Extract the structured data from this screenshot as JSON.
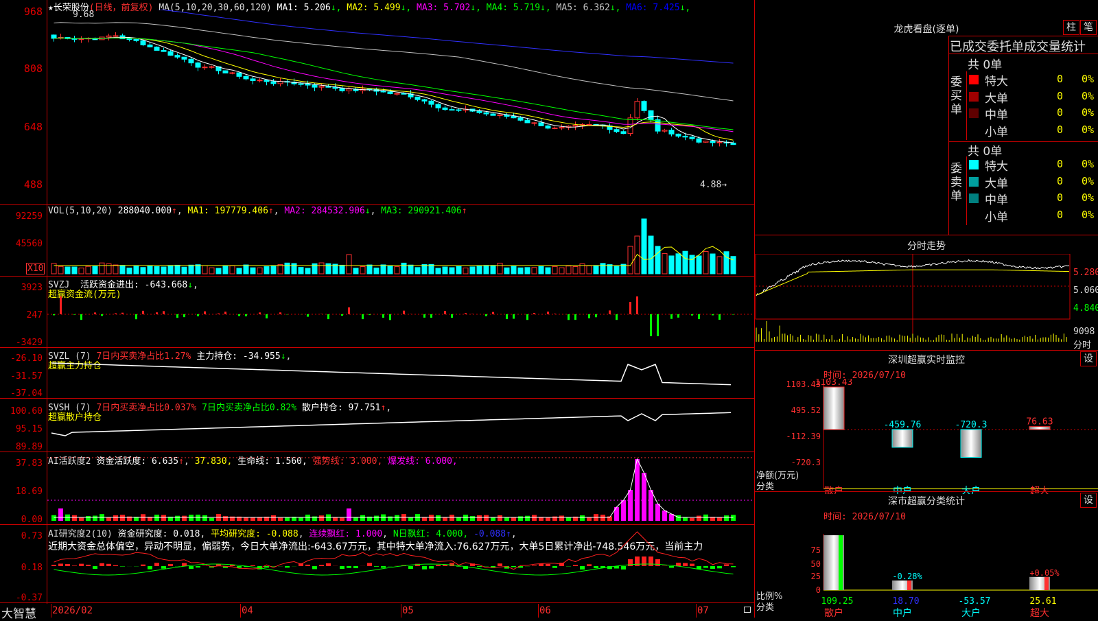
{
  "stock": {
    "star": "★",
    "name": "长荣股份",
    "period": "(日线，前复权)",
    "ma_header": "MA(5,10,20,30,60,120)",
    "ma_values": [
      {
        "label": "MA1:",
        "value": "5.206",
        "arrow": "↓",
        "color": "#ffffff"
      },
      {
        "label": "MA2:",
        "value": "5.499",
        "arrow": "↓",
        "color": "#ffff00"
      },
      {
        "label": "MA3:",
        "value": "5.702",
        "arrow": "↓",
        "color": "#ff00ff"
      },
      {
        "label": "MA4:",
        "value": "5.719",
        "arrow": "↓",
        "color": "#00ff00"
      },
      {
        "label": "MA5:",
        "value": "6.362",
        "arrow": "↓",
        "color": "#c0c0c0"
      },
      {
        "label": "MA6:",
        "value": "7.425",
        "arrow": "↓",
        "color": "#0000ff"
      }
    ],
    "price_axis": [
      "968",
      "808",
      "648",
      "488"
    ],
    "high_marker": "9.68",
    "low_marker": "4.88→"
  },
  "vol": {
    "header": "VOL(5,10,20)",
    "value": "288040.000",
    "ma1": "MA1: 197779.406",
    "ma2": "MA2: 284532.906",
    "ma3": "MA3: 290921.406",
    "axis": [
      "92259",
      "45560"
    ],
    "unit": "X10"
  },
  "svzj": {
    "header": "SVZJ",
    "label": "活跃资金进出: -643.668",
    "subtitle": "超赢资金流(万元)",
    "axis": [
      "3923",
      "247",
      "-3429"
    ]
  },
  "svzl": {
    "header": "SVZL (7)",
    "label1": "7日内买卖净占比1.27%",
    "label2": "主力持仓: -34.955",
    "subtitle": "超赢主力持仓",
    "axis": [
      "-26.10",
      "-31.57",
      "-37.04"
    ]
  },
  "svsh": {
    "header": "SVSH (7)",
    "label1": "7日内买卖净占比0.037%",
    "label2": "7日内买卖净占比0.82%",
    "label3": "散户持仓: 97.751",
    "subtitle": "超赢散户持仓",
    "axis": [
      "100.60",
      "95.15",
      "89.89"
    ]
  },
  "ai_active": {
    "header": "AI活跃度2",
    "l1": "资金活跃度: 6.635",
    "l2": "37.830,",
    "l3": "生命线: 1.560,",
    "l4": "强势线: 3.000,",
    "l5": "爆发线: 6.000,",
    "axis": [
      "37.83",
      "18.69",
      "0.00"
    ]
  },
  "ai_research": {
    "header": "AI研究度2(10)",
    "l1": "资金研究度: 0.018",
    "l2": "平均研究度: -0.088",
    "l3": "连续飘红: 1.000",
    "l4": "N日飘红: 4.000,",
    "l5": "-0.088",
    "summary": "近期大资金总体偏空，异动不明显，偏弱势，今日大单净流出:-643.67万元，其中特大单净流入:76.627万元，大单5日累计净出-748.546万元，当前主力",
    "axis": [
      "0.73",
      "0.18",
      "-0.37"
    ]
  },
  "bottom_axis": {
    "brand": "大智慧",
    "dates": [
      "2026/02",
      "04",
      "05",
      "06",
      "07"
    ]
  },
  "right": {
    "lhb_title": "龙虎看盘(逐单)",
    "btn_zhu": "柱",
    "btn_bi": "笔",
    "stats_title": "已成交委托单成交量统计",
    "buy_side": "委买单",
    "sell_side": "委卖单",
    "buy_total": "共 0单",
    "sell_total": "共 0单",
    "buy_rows": [
      {
        "label": "特大",
        "count": "0",
        "pct": "0%",
        "color": "#ff0000"
      },
      {
        "label": "大单",
        "count": "0",
        "pct": "0%",
        "color": "#a00000"
      },
      {
        "label": "中单",
        "count": "0",
        "pct": "0%",
        "color": "#600000"
      },
      {
        "label": "小单",
        "count": "0",
        "pct": "0%",
        "color": ""
      }
    ],
    "sell_rows": [
      {
        "label": "特大",
        "count": "0",
        "pct": "0%",
        "color": "#00ffff"
      },
      {
        "label": "大单",
        "count": "0",
        "pct": "0%",
        "color": "#00a0a0"
      },
      {
        "label": "中单",
        "count": "0",
        "pct": "0%",
        "color": "#008080"
      },
      {
        "label": "小单",
        "count": "0",
        "pct": "0%",
        "color": ""
      }
    ],
    "intraday_title": "分时走势",
    "intraday_axis": [
      "5.280",
      "5.060",
      "4.840"
    ],
    "intraday_vol": "9098",
    "intraday_vol_label": "分时",
    "monitor": {
      "title": "深圳超赢实时监控",
      "btn": "设",
      "time": "时间: 2026/07/10",
      "axis": [
        "1103.43",
        "495.52",
        "-112.39",
        "-720.3"
      ],
      "ylabel1": "净额(万元)",
      "ylabel2": "分类",
      "bars": [
        {
          "cat": "散户",
          "value": "1103.43"
        },
        {
          "cat": "中户",
          "value": "-459.76"
        },
        {
          "cat": "大户",
          "value": "-720.3"
        },
        {
          "cat": "超大",
          "value": "76.63"
        }
      ]
    },
    "classify": {
      "title": "深市超赢分类统计",
      "btn": "设",
      "time": "时间: 2026/07/10",
      "axis": [
        "75",
        "50",
        "25",
        "0"
      ],
      "ylabel1": "比例%",
      "ylabel2": "分类",
      "bars": [
        {
          "cat": "散户",
          "value": "109.25",
          "label": ""
        },
        {
          "cat": "中户",
          "value": "18.70",
          "label": "-0.28%"
        },
        {
          "cat": "大户",
          "value": "-53.57",
          "label": ""
        },
        {
          "cat": "超大",
          "value": "25.61",
          "label": "+0.05%"
        }
      ]
    }
  },
  "colors": {
    "up": "#ff3030",
    "down": "#00ffff",
    "grid": "#c00000",
    "yellow": "#ffff00",
    "magenta": "#ff00ff",
    "green": "#00ff00",
    "blue": "#3030ff"
  }
}
